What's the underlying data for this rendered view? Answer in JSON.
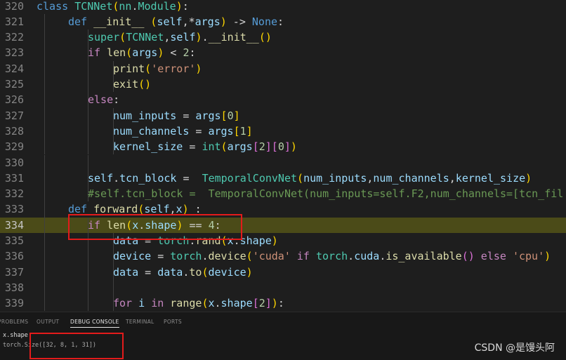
{
  "editor": {
    "lines": [
      {
        "n": "320",
        "tokens": [
          [
            "class ",
            "kw"
          ],
          [
            "TCNNet",
            "cls"
          ],
          [
            "(",
            "br1"
          ],
          [
            "nn",
            "cls"
          ],
          [
            ".",
            "plain"
          ],
          [
            "Module",
            "cls"
          ],
          [
            ")",
            "br1"
          ],
          [
            ":",
            "plain"
          ]
        ]
      },
      {
        "n": "321",
        "indent": 1,
        "tokens": [
          [
            "def ",
            "kw"
          ],
          [
            "__init__",
            "fn"
          ],
          [
            " ",
            "plain"
          ],
          [
            "(",
            "br1"
          ],
          [
            "self",
            "var"
          ],
          [
            ",*",
            "plain"
          ],
          [
            "args",
            "var"
          ],
          [
            ")",
            "br1"
          ],
          [
            " -> ",
            "plain"
          ],
          [
            "None",
            "kw"
          ],
          [
            ":",
            "plain"
          ]
        ]
      },
      {
        "n": "322",
        "indent": 2,
        "tokens": [
          [
            "super",
            "cls"
          ],
          [
            "(",
            "br1"
          ],
          [
            "TCNNet",
            "cls"
          ],
          [
            ",",
            "plain"
          ],
          [
            "self",
            "var"
          ],
          [
            ")",
            "br1"
          ],
          [
            ".",
            "plain"
          ],
          [
            "__init__",
            "fn"
          ],
          [
            "()",
            "br1"
          ]
        ]
      },
      {
        "n": "323",
        "indent": 2,
        "tokens": [
          [
            "if ",
            "ctrl"
          ],
          [
            "len",
            "fn"
          ],
          [
            "(",
            "br1"
          ],
          [
            "args",
            "var"
          ],
          [
            ")",
            "br1"
          ],
          [
            " < ",
            "plain"
          ],
          [
            "2",
            "num"
          ],
          [
            ":",
            "plain"
          ]
        ]
      },
      {
        "n": "324",
        "indent": 3,
        "tokens": [
          [
            "print",
            "fn"
          ],
          [
            "(",
            "br1"
          ],
          [
            "'error'",
            "str"
          ],
          [
            ")",
            "br1"
          ]
        ]
      },
      {
        "n": "325",
        "indent": 3,
        "tokens": [
          [
            "exit",
            "fn"
          ],
          [
            "()",
            "br1"
          ]
        ]
      },
      {
        "n": "326",
        "indent": 2,
        "tokens": [
          [
            "else",
            "ctrl"
          ],
          [
            ":",
            "plain"
          ]
        ]
      },
      {
        "n": "327",
        "indent": 3,
        "tokens": [
          [
            "num_inputs",
            "var"
          ],
          [
            " = ",
            "plain"
          ],
          [
            "args",
            "var"
          ],
          [
            "[",
            "br1"
          ],
          [
            "0",
            "num"
          ],
          [
            "]",
            "br1"
          ]
        ]
      },
      {
        "n": "328",
        "indent": 3,
        "tokens": [
          [
            "num_channels",
            "var"
          ],
          [
            " = ",
            "plain"
          ],
          [
            "args",
            "var"
          ],
          [
            "[",
            "br1"
          ],
          [
            "1",
            "num"
          ],
          [
            "]",
            "br1"
          ]
        ]
      },
      {
        "n": "329",
        "indent": 3,
        "tokens": [
          [
            "kernel_size",
            "var"
          ],
          [
            " = ",
            "plain"
          ],
          [
            "int",
            "cls"
          ],
          [
            "(",
            "br1"
          ],
          [
            "args",
            "var"
          ],
          [
            "[",
            "br2"
          ],
          [
            "2",
            "num"
          ],
          [
            "]",
            "br2"
          ],
          [
            "[",
            "br2"
          ],
          [
            "0",
            "num"
          ],
          [
            "]",
            "br2"
          ],
          [
            ")",
            "br1"
          ]
        ]
      },
      {
        "n": "330",
        "indent": 2,
        "tokens": []
      },
      {
        "n": "331",
        "indent": 2,
        "tokens": [
          [
            "self",
            "var"
          ],
          [
            ".",
            "plain"
          ],
          [
            "tcn_block",
            "var"
          ],
          [
            " =  ",
            "plain"
          ],
          [
            "TemporalConvNet",
            "cls"
          ],
          [
            "(",
            "br1"
          ],
          [
            "num_inputs",
            "var"
          ],
          [
            ",",
            "plain"
          ],
          [
            "num_channels",
            "var"
          ],
          [
            ",",
            "plain"
          ],
          [
            "kernel_size",
            "var"
          ],
          [
            ")",
            "br1"
          ]
        ]
      },
      {
        "n": "332",
        "indent": 2,
        "tokens": [
          [
            "#self.tcn_block =  TemporalConvNet(num_inputs=self.F2,num_channels=[tcn_fil",
            "cmt"
          ]
        ]
      },
      {
        "n": "333",
        "indent": 1,
        "tokens": [
          [
            "def ",
            "kw"
          ],
          [
            "forward",
            "fn"
          ],
          [
            "(",
            "br1"
          ],
          [
            "self",
            "var"
          ],
          [
            ",",
            "plain"
          ],
          [
            "x",
            "var"
          ],
          [
            ")",
            "br1"
          ],
          [
            " :",
            "plain"
          ]
        ]
      },
      {
        "n": "334",
        "indent": 2,
        "hl": true,
        "tokens": [
          [
            "if ",
            "ctrl"
          ],
          [
            "len",
            "fn"
          ],
          [
            "(",
            "br1"
          ],
          [
            "x",
            "var"
          ],
          [
            ".",
            "plain"
          ],
          [
            "shape",
            "var"
          ],
          [
            ")",
            "br1"
          ],
          [
            " == ",
            "plain"
          ],
          [
            "4",
            "num"
          ],
          [
            ":",
            "plain"
          ]
        ]
      },
      {
        "n": "335",
        "indent": 3,
        "tokens": [
          [
            "data",
            "var"
          ],
          [
            " = ",
            "plain"
          ],
          [
            "torch",
            "cls"
          ],
          [
            ".",
            "plain"
          ],
          [
            "rand",
            "fn"
          ],
          [
            "(",
            "br1"
          ],
          [
            "x",
            "var"
          ],
          [
            ".",
            "plain"
          ],
          [
            "shape",
            "var"
          ],
          [
            ")",
            "br1"
          ]
        ]
      },
      {
        "n": "336",
        "indent": 3,
        "tokens": [
          [
            "device",
            "var"
          ],
          [
            " = ",
            "plain"
          ],
          [
            "torch",
            "cls"
          ],
          [
            ".",
            "plain"
          ],
          [
            "device",
            "fn"
          ],
          [
            "(",
            "br1"
          ],
          [
            "'cuda'",
            "str"
          ],
          [
            " if ",
            "ctrl"
          ],
          [
            "torch",
            "cls"
          ],
          [
            ".",
            "plain"
          ],
          [
            "cuda",
            "var"
          ],
          [
            ".",
            "plain"
          ],
          [
            "is_available",
            "fn"
          ],
          [
            "()",
            "br2"
          ],
          [
            " else ",
            "ctrl"
          ],
          [
            "'cpu'",
            "str"
          ],
          [
            ")",
            "br1"
          ]
        ]
      },
      {
        "n": "337",
        "indent": 3,
        "tokens": [
          [
            "data",
            "var"
          ],
          [
            " = ",
            "plain"
          ],
          [
            "data",
            "var"
          ],
          [
            ".",
            "plain"
          ],
          [
            "to",
            "fn"
          ],
          [
            "(",
            "br1"
          ],
          [
            "device",
            "var"
          ],
          [
            ")",
            "br1"
          ]
        ]
      },
      {
        "n": "338",
        "indent": 3,
        "tokens": []
      },
      {
        "n": "339",
        "indent": 3,
        "tokens": [
          [
            "for ",
            "ctrl"
          ],
          [
            "i ",
            "var"
          ],
          [
            "in ",
            "ctrl"
          ],
          [
            "range",
            "fn"
          ],
          [
            "(",
            "br1"
          ],
          [
            "x",
            "var"
          ],
          [
            ".",
            "plain"
          ],
          [
            "shape",
            "var"
          ],
          [
            "[",
            "br2"
          ],
          [
            "2",
            "num"
          ],
          [
            "]",
            "br2"
          ],
          [
            ")",
            "br1"
          ],
          [
            ":",
            "plain"
          ]
        ]
      }
    ]
  },
  "panel": {
    "tabs": [
      {
        "label": "PROBLEMS",
        "active": false
      },
      {
        "label": "OUTPUT",
        "active": false
      },
      {
        "label": "DEBUG CONSOLE",
        "active": true
      },
      {
        "label": "TERMINAL",
        "active": false
      },
      {
        "label": "PORTS",
        "active": false
      }
    ],
    "console": {
      "input": "x.shape",
      "output": "torch.Size([32, 8, 1, 31])"
    }
  },
  "watermark": "CSDN @是馒头阿",
  "colors": {
    "highlight_line": "#4b4b18",
    "annotation_box": "#e31b1b"
  }
}
